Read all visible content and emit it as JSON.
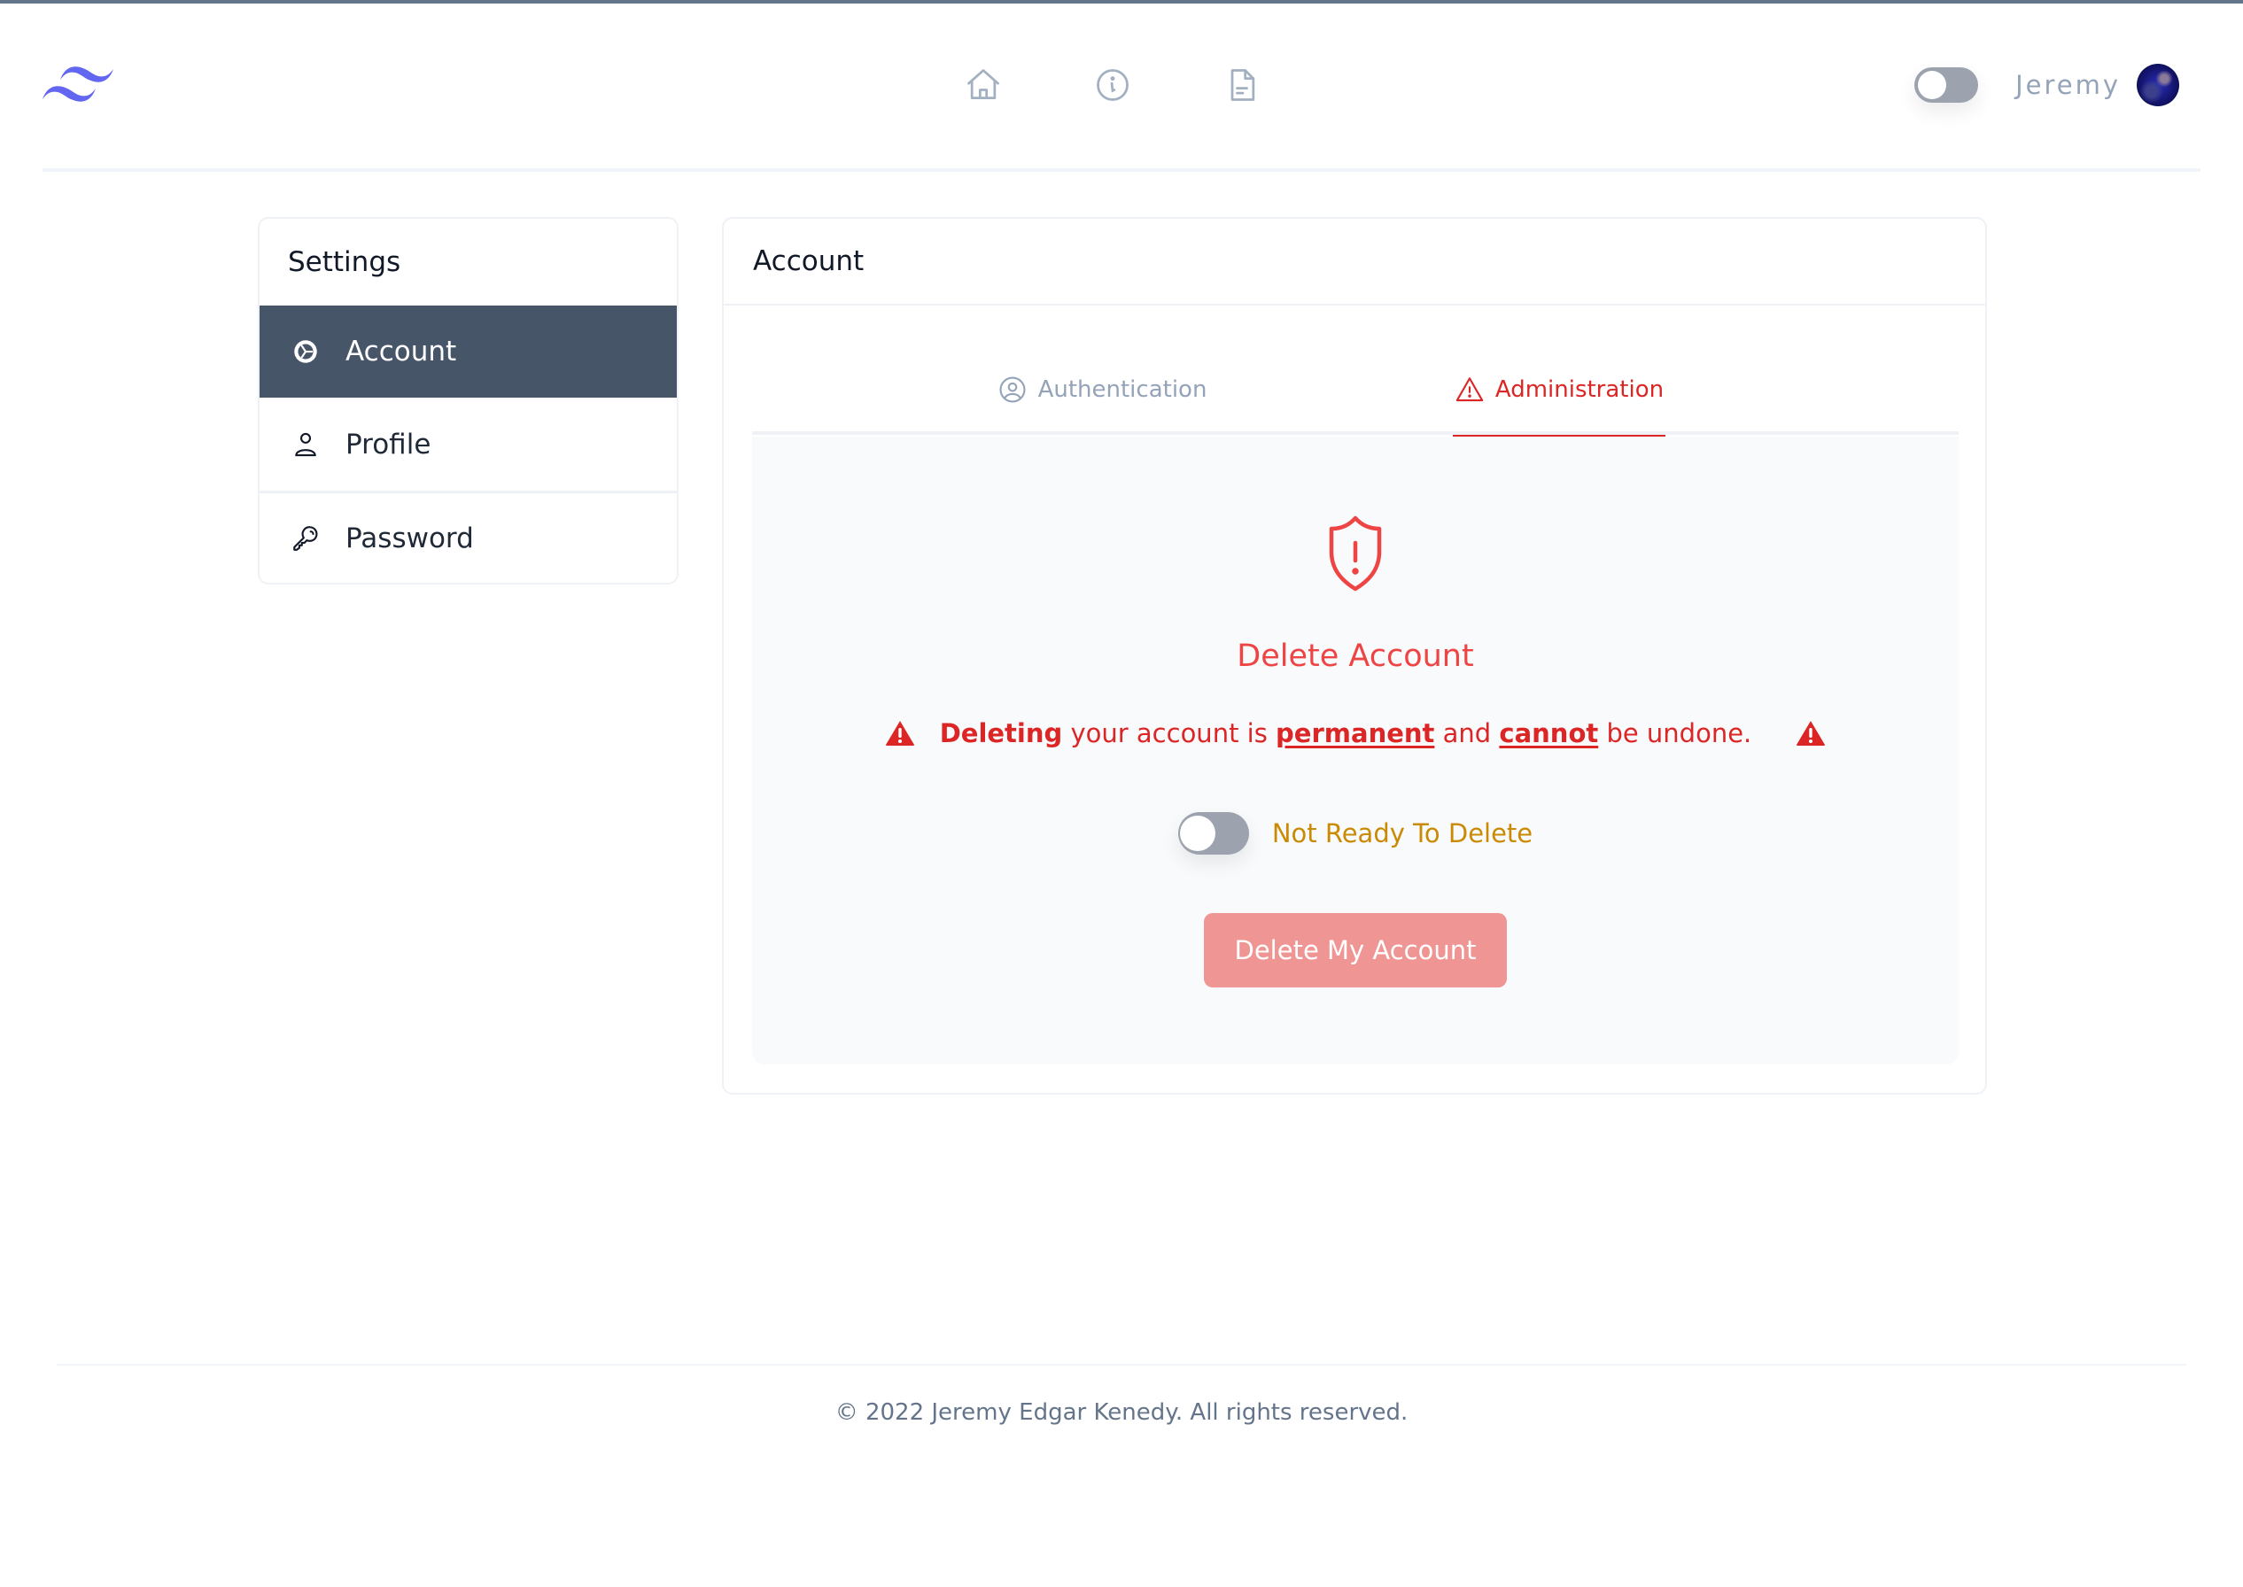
{
  "header": {
    "logo": "tailwind-logo",
    "nav_icons": [
      "home-icon",
      "info-icon",
      "document-icon"
    ],
    "theme_toggle": {
      "state": "off"
    },
    "username": "Jeremy",
    "avatar": "user-avatar"
  },
  "sidebar": {
    "title": "Settings",
    "items": [
      {
        "label": "Account",
        "icon": "gear-icon",
        "active": true
      },
      {
        "label": "Profile",
        "icon": "user-icon",
        "active": false
      },
      {
        "label": "Password",
        "icon": "key-icon",
        "active": false
      }
    ]
  },
  "main": {
    "title": "Account",
    "tabs": [
      {
        "label": "Authentication",
        "icon": "user-circle-icon",
        "active": false
      },
      {
        "label": "Administration",
        "icon": "warning-icon",
        "active": true
      }
    ],
    "panel": {
      "icon": "shield-exclamation-icon",
      "heading": "Delete Account",
      "warning": {
        "strong": "Deleting",
        "part1": " your account is ",
        "emph1": "permanent",
        "part2": " and ",
        "emph2": "cannot",
        "part3": " be undone."
      },
      "confirm_toggle": {
        "state": "off",
        "label": "Not Ready To Delete"
      },
      "delete_button": "Delete My Account"
    }
  },
  "footer": {
    "text": "© 2022 Jeremy Edgar Kenedy. All rights reserved."
  },
  "colors": {
    "accent_danger": "#dc2626",
    "sidebar_active": "#475569",
    "warning_label": "#ca8a04",
    "button_disabled": "#ef9593",
    "logo": "#6366f1"
  }
}
